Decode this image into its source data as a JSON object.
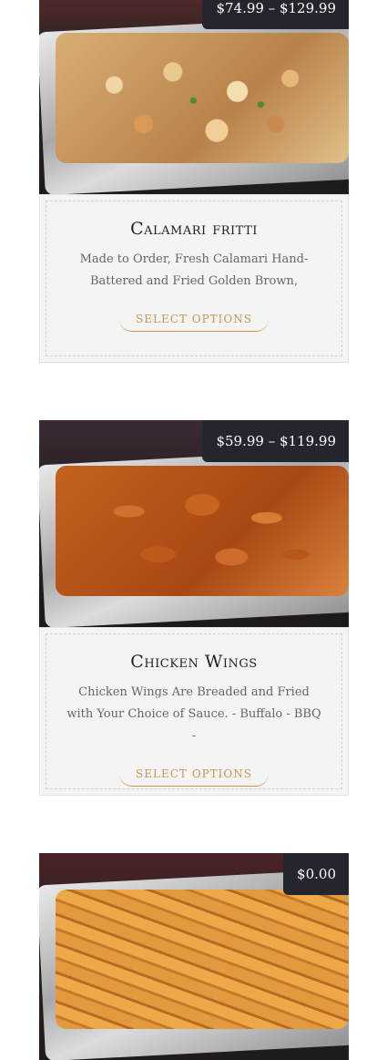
{
  "products": [
    {
      "price": "$74.99 – $129.99",
      "title": "Calamari fritti",
      "description": "Made to Order, Fresh Calamari Hand-Battered and Fried Golden Brown,",
      "button": "SELECT OPTIONS"
    },
    {
      "price": "$59.99 – $119.99",
      "title": "Chicken Wings",
      "description": "Chicken Wings Are Breaded and Fried with Your Choice of Sauce. - Buffalo - BBQ -",
      "button": "SELECT OPTIONS"
    },
    {
      "price": "$0.00",
      "title": "",
      "description": "",
      "button": ""
    }
  ]
}
